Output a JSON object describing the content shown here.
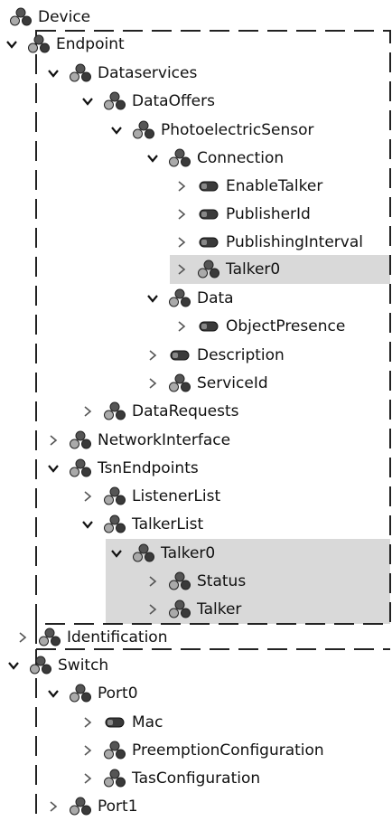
{
  "tree": {
    "nodes": [
      {
        "label": "Device",
        "icon": "group-icon",
        "expander": "none"
      },
      {
        "label": "Endpoint",
        "icon": "group-icon",
        "expander": "expanded"
      },
      {
        "label": "Dataservices",
        "icon": "group-icon",
        "expander": "expanded"
      },
      {
        "label": "DataOffers",
        "icon": "group-icon",
        "expander": "expanded"
      },
      {
        "label": "PhotoelectricSensor",
        "icon": "group-icon",
        "expander": "expanded"
      },
      {
        "label": "Connection",
        "icon": "group-icon",
        "expander": "expanded"
      },
      {
        "label": "EnableTalker",
        "icon": "property-icon",
        "expander": "collapsed"
      },
      {
        "label": "PublisherId",
        "icon": "property-icon",
        "expander": "collapsed"
      },
      {
        "label": "PublishingInterval",
        "icon": "property-icon",
        "expander": "collapsed"
      },
      {
        "label": "Talker0",
        "icon": "group-icon",
        "expander": "collapsed",
        "selected": true
      },
      {
        "label": "Data",
        "icon": "group-icon",
        "expander": "expanded"
      },
      {
        "label": "ObjectPresence",
        "icon": "property-icon",
        "expander": "collapsed"
      },
      {
        "label": "Description",
        "icon": "property-icon",
        "expander": "collapsed"
      },
      {
        "label": "ServiceId",
        "icon": "group-icon",
        "expander": "collapsed"
      },
      {
        "label": "DataRequests",
        "icon": "group-icon",
        "expander": "collapsed"
      },
      {
        "label": "NetworkInterface",
        "icon": "group-icon",
        "expander": "collapsed"
      },
      {
        "label": "TsnEndpoints",
        "icon": "group-icon",
        "expander": "expanded"
      },
      {
        "label": "ListenerList",
        "icon": "group-icon",
        "expander": "collapsed"
      },
      {
        "label": "TalkerList",
        "icon": "group-icon",
        "expander": "expanded"
      },
      {
        "label": "Talker0",
        "icon": "group-icon",
        "expander": "expanded",
        "selected": true
      },
      {
        "label": "Status",
        "icon": "group-icon",
        "expander": "collapsed",
        "selected": true
      },
      {
        "label": "Talker",
        "icon": "group-icon",
        "expander": "collapsed",
        "selected": true
      },
      {
        "label": "Identification",
        "icon": "group-icon",
        "expander": "collapsed"
      },
      {
        "label": "Switch",
        "icon": "group-icon",
        "expander": "expanded"
      },
      {
        "label": "Port0",
        "icon": "group-icon",
        "expander": "expanded"
      },
      {
        "label": "Mac",
        "icon": "property-icon",
        "expander": "collapsed"
      },
      {
        "label": "PreemptionConfiguration",
        "icon": "group-icon",
        "expander": "collapsed"
      },
      {
        "label": "TasConfiguration",
        "icon": "group-icon",
        "expander": "collapsed"
      },
      {
        "label": "Port1",
        "icon": "group-icon",
        "expander": "collapsed"
      }
    ]
  },
  "colors": {
    "selection": "#d9d9d9",
    "dash": "#222222",
    "icon_dark": "#3a3a3a",
    "icon_light": "#a8a8a8"
  }
}
